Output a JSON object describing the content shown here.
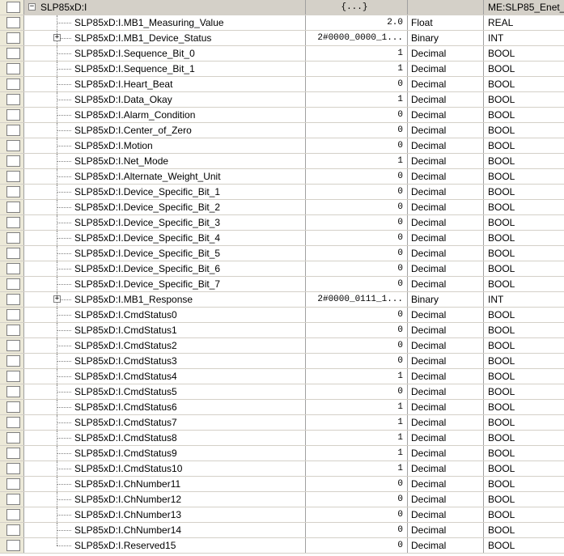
{
  "root": {
    "name": "SLP85xD:I",
    "value": "{...}",
    "style": "",
    "type": "ME:SLP85_Enet_...",
    "expander": "−"
  },
  "rows": [
    {
      "name": "SLP85xD:I.MB1_Measuring_Value",
      "value": "2.0",
      "style": "Float",
      "type": "REAL",
      "expandable": false
    },
    {
      "name": "SLP85xD:I.MB1_Device_Status",
      "value": "2#0000_0000_1...",
      "style": "Binary",
      "type": "INT",
      "expandable": true,
      "expander": "+"
    },
    {
      "name": "SLP85xD:I.Sequence_Bit_0",
      "value": "1",
      "style": "Decimal",
      "type": "BOOL",
      "expandable": false
    },
    {
      "name": "SLP85xD:I.Sequence_Bit_1",
      "value": "1",
      "style": "Decimal",
      "type": "BOOL",
      "expandable": false
    },
    {
      "name": "SLP85xD:I.Heart_Beat",
      "value": "0",
      "style": "Decimal",
      "type": "BOOL",
      "expandable": false
    },
    {
      "name": "SLP85xD:I.Data_Okay",
      "value": "1",
      "style": "Decimal",
      "type": "BOOL",
      "expandable": false
    },
    {
      "name": "SLP85xD:I.Alarm_Condition",
      "value": "0",
      "style": "Decimal",
      "type": "BOOL",
      "expandable": false
    },
    {
      "name": "SLP85xD:I.Center_of_Zero",
      "value": "0",
      "style": "Decimal",
      "type": "BOOL",
      "expandable": false
    },
    {
      "name": "SLP85xD:I.Motion",
      "value": "0",
      "style": "Decimal",
      "type": "BOOL",
      "expandable": false
    },
    {
      "name": "SLP85xD:I.Net_Mode",
      "value": "1",
      "style": "Decimal",
      "type": "BOOL",
      "expandable": false
    },
    {
      "name": "SLP85xD:I.Alternate_Weight_Unit",
      "value": "0",
      "style": "Decimal",
      "type": "BOOL",
      "expandable": false
    },
    {
      "name": "SLP85xD:I.Device_Specific_Bit_1",
      "value": "0",
      "style": "Decimal",
      "type": "BOOL",
      "expandable": false
    },
    {
      "name": "SLP85xD:I.Device_Specific_Bit_2",
      "value": "0",
      "style": "Decimal",
      "type": "BOOL",
      "expandable": false
    },
    {
      "name": "SLP85xD:I.Device_Specific_Bit_3",
      "value": "0",
      "style": "Decimal",
      "type": "BOOL",
      "expandable": false
    },
    {
      "name": "SLP85xD:I.Device_Specific_Bit_4",
      "value": "0",
      "style": "Decimal",
      "type": "BOOL",
      "expandable": false
    },
    {
      "name": "SLP85xD:I.Device_Specific_Bit_5",
      "value": "0",
      "style": "Decimal",
      "type": "BOOL",
      "expandable": false
    },
    {
      "name": "SLP85xD:I.Device_Specific_Bit_6",
      "value": "0",
      "style": "Decimal",
      "type": "BOOL",
      "expandable": false
    },
    {
      "name": "SLP85xD:I.Device_Specific_Bit_7",
      "value": "0",
      "style": "Decimal",
      "type": "BOOL",
      "expandable": false
    },
    {
      "name": "SLP85xD:I.MB1_Response",
      "value": "2#0000_0111_1...",
      "style": "Binary",
      "type": "INT",
      "expandable": true,
      "expander": "+"
    },
    {
      "name": "SLP85xD:I.CmdStatus0",
      "value": "0",
      "style": "Decimal",
      "type": "BOOL",
      "expandable": false
    },
    {
      "name": "SLP85xD:I.CmdStatus1",
      "value": "0",
      "style": "Decimal",
      "type": "BOOL",
      "expandable": false
    },
    {
      "name": "SLP85xD:I.CmdStatus2",
      "value": "0",
      "style": "Decimal",
      "type": "BOOL",
      "expandable": false
    },
    {
      "name": "SLP85xD:I.CmdStatus3",
      "value": "0",
      "style": "Decimal",
      "type": "BOOL",
      "expandable": false
    },
    {
      "name": "SLP85xD:I.CmdStatus4",
      "value": "1",
      "style": "Decimal",
      "type": "BOOL",
      "expandable": false
    },
    {
      "name": "SLP85xD:I.CmdStatus5",
      "value": "0",
      "style": "Decimal",
      "type": "BOOL",
      "expandable": false
    },
    {
      "name": "SLP85xD:I.CmdStatus6",
      "value": "1",
      "style": "Decimal",
      "type": "BOOL",
      "expandable": false
    },
    {
      "name": "SLP85xD:I.CmdStatus7",
      "value": "1",
      "style": "Decimal",
      "type": "BOOL",
      "expandable": false
    },
    {
      "name": "SLP85xD:I.CmdStatus8",
      "value": "1",
      "style": "Decimal",
      "type": "BOOL",
      "expandable": false
    },
    {
      "name": "SLP85xD:I.CmdStatus9",
      "value": "1",
      "style": "Decimal",
      "type": "BOOL",
      "expandable": false
    },
    {
      "name": "SLP85xD:I.CmdStatus10",
      "value": "1",
      "style": "Decimal",
      "type": "BOOL",
      "expandable": false
    },
    {
      "name": "SLP85xD:I.ChNumber11",
      "value": "0",
      "style": "Decimal",
      "type": "BOOL",
      "expandable": false
    },
    {
      "name": "SLP85xD:I.ChNumber12",
      "value": "0",
      "style": "Decimal",
      "type": "BOOL",
      "expandable": false
    },
    {
      "name": "SLP85xD:I.ChNumber13",
      "value": "0",
      "style": "Decimal",
      "type": "BOOL",
      "expandable": false
    },
    {
      "name": "SLP85xD:I.ChNumber14",
      "value": "0",
      "style": "Decimal",
      "type": "BOOL",
      "expandable": false
    },
    {
      "name": "SLP85xD:I.Reserved15",
      "value": "0",
      "style": "Decimal",
      "type": "BOOL",
      "expandable": false
    }
  ]
}
